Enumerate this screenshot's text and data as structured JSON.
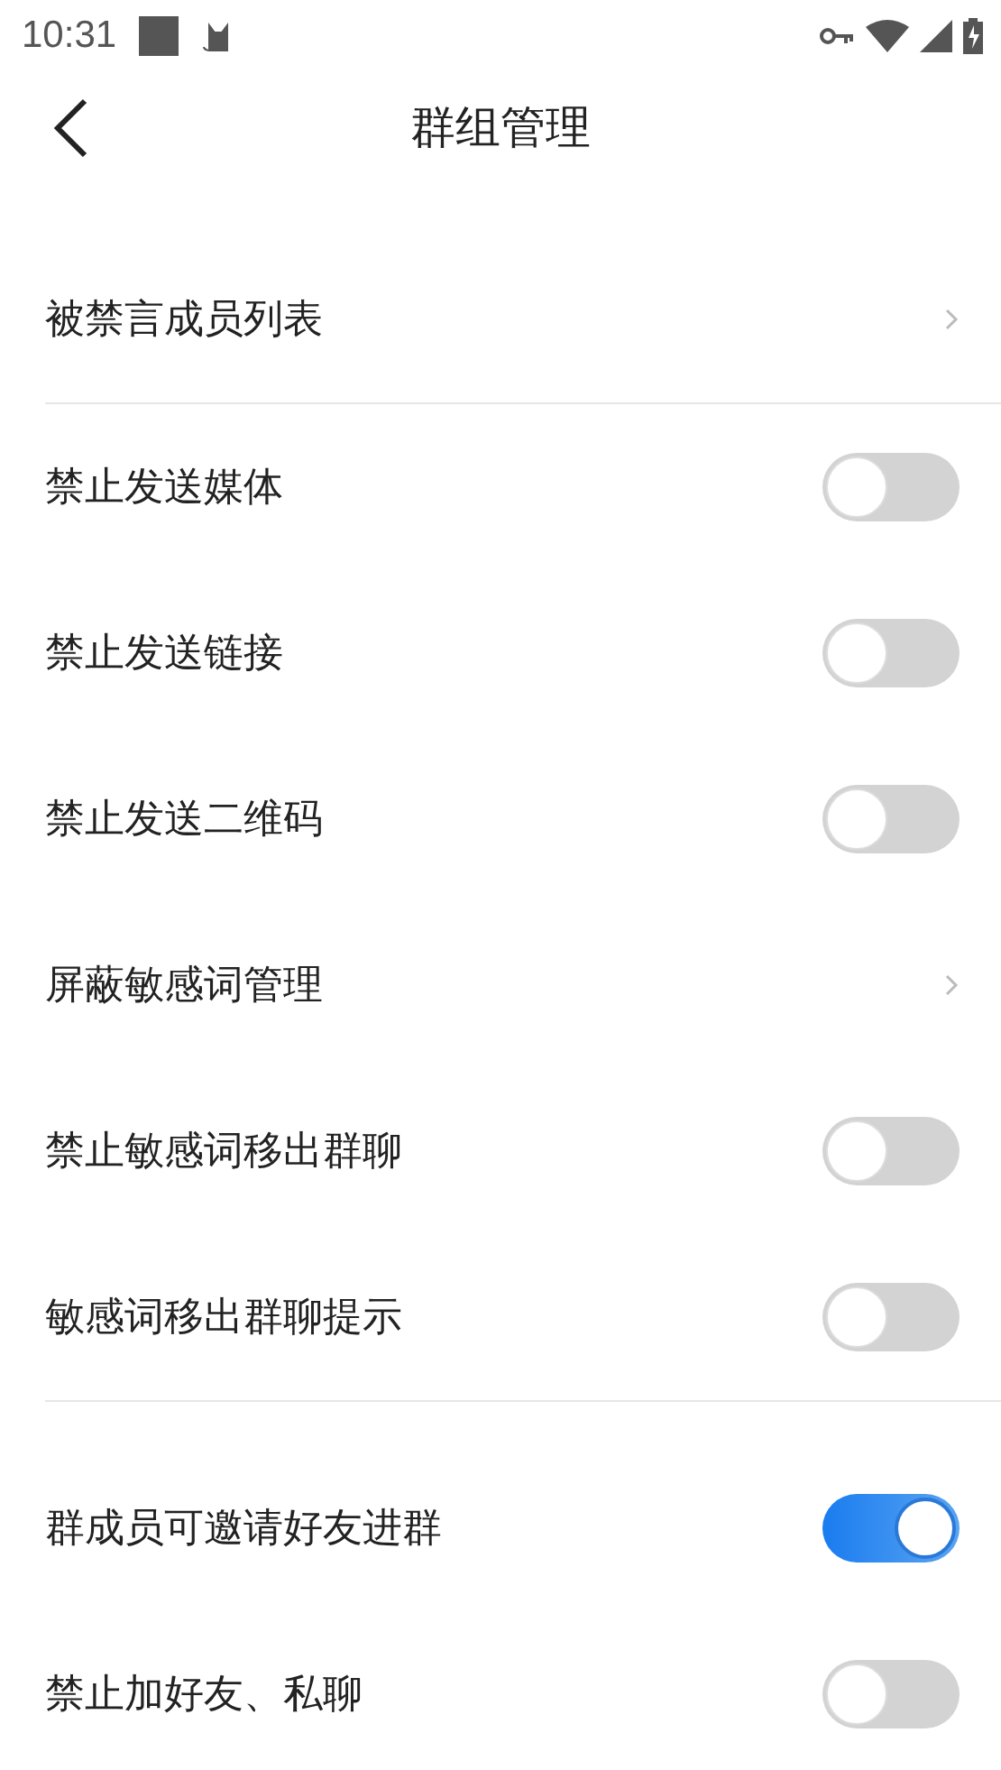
{
  "status_bar": {
    "time": "10:31"
  },
  "header": {
    "title": "群组管理"
  },
  "groups": [
    {
      "rows": [
        {
          "kind": "link",
          "label": "被禁言成员列表"
        }
      ]
    },
    {
      "rows": [
        {
          "kind": "toggle",
          "label": "禁止发送媒体",
          "on": false
        },
        {
          "kind": "toggle",
          "label": "禁止发送链接",
          "on": false
        },
        {
          "kind": "toggle",
          "label": "禁止发送二维码",
          "on": false
        },
        {
          "kind": "link",
          "label": "屏蔽敏感词管理"
        },
        {
          "kind": "toggle",
          "label": "禁止敏感词移出群聊",
          "on": false
        },
        {
          "kind": "toggle",
          "label": "敏感词移出群聊提示",
          "on": false
        }
      ]
    },
    {
      "rows": [
        {
          "kind": "toggle",
          "label": "群成员可邀请好友进群",
          "on": true
        },
        {
          "kind": "toggle",
          "label": "禁止加好友、私聊",
          "on": false
        }
      ]
    }
  ]
}
